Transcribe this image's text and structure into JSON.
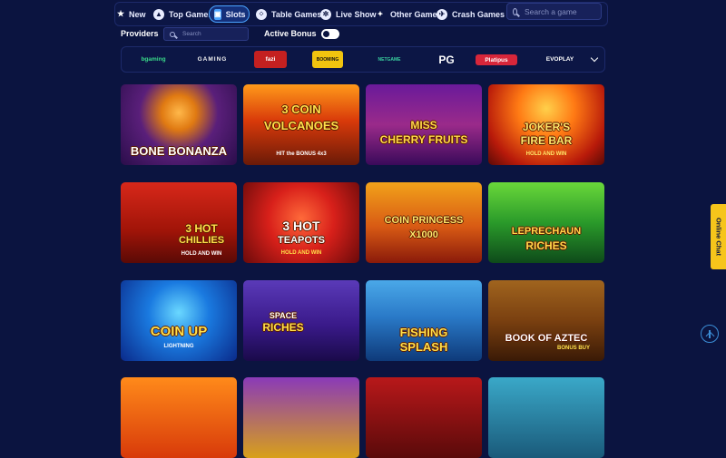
{
  "categories": [
    {
      "label": "New",
      "icon": "star-icon"
    },
    {
      "label": "Top Games",
      "icon": "flame-icon"
    },
    {
      "label": "Slots",
      "icon": "slot-machine-icon",
      "active": true
    },
    {
      "label": "Table Games",
      "icon": "dice-icon"
    },
    {
      "label": "Live Show",
      "icon": "live-show-icon"
    },
    {
      "label": "Other Games",
      "icon": "other-games-icon"
    },
    {
      "label": "Crash Games",
      "icon": "crash-games-icon"
    }
  ],
  "search": {
    "placeholder": "Search a game"
  },
  "providers": {
    "label": "Providers",
    "search_placeholder": "Search",
    "active_bonus_label": "Active Bonus",
    "active_bonus_on": false,
    "items": [
      "bgaming",
      "GAMING",
      "fazi",
      "BOOMING",
      "NETGAME",
      "PG",
      "Platipus",
      "EVOPLAY"
    ]
  },
  "games": [
    {
      "title": "BONE BONANZA",
      "line2": "",
      "sub": ""
    },
    {
      "title": "3 COIN",
      "line2": "VOLCANOES",
      "sub": "HIT the BONUS 4x3"
    },
    {
      "title": "MISS",
      "line2": "CHERRY FRUITS",
      "sub": ""
    },
    {
      "title": "JOKER'S",
      "line2": "FIRE BAR",
      "sub": "HOLD AND WIN"
    },
    {
      "title": "3 HOT",
      "line2": "CHILLIES",
      "sub": "HOLD AND WIN"
    },
    {
      "title": "3 HOT",
      "line2": "TEAPOTS",
      "sub": "HOLD AND WIN"
    },
    {
      "title": "COIN PRINCESS",
      "line2": "X1000",
      "sub": ""
    },
    {
      "title": "LEPRECHAUN",
      "line2": "RICHES",
      "sub": ""
    },
    {
      "title": "COIN UP",
      "line2": "",
      "sub": "LIGHTNING"
    },
    {
      "title": "SPACE",
      "line2": "RICHES",
      "sub": ""
    },
    {
      "title": "FISHING",
      "line2": "SPLASH",
      "sub": ""
    },
    {
      "title": "BOOK OF AZTEC",
      "line2": "",
      "sub": "BONUS BUY"
    }
  ],
  "side": {
    "chat_label": "Online Chat"
  },
  "colors": {
    "background": "#0b1440",
    "accent": "#4aa3ff",
    "chat": "#f6c51b"
  }
}
